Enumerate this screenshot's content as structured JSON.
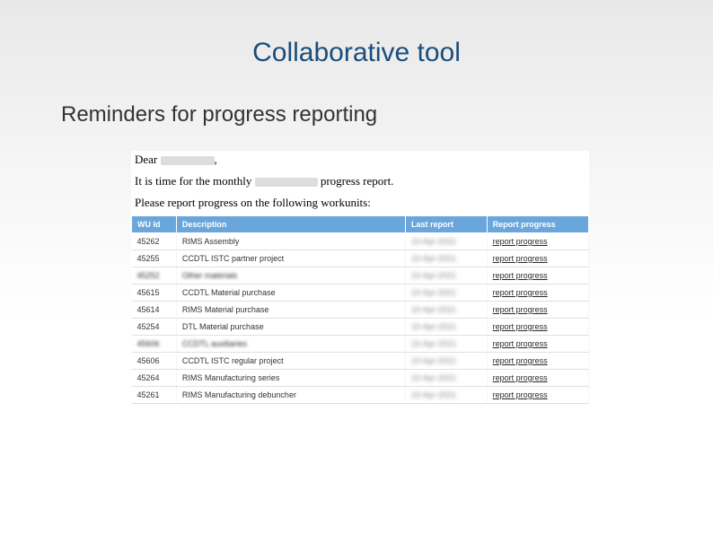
{
  "title": "Collaborative tool",
  "subtitle": "Reminders for progress reporting",
  "email": {
    "greeting_prefix": "Dear",
    "line2_prefix": "It is time for the monthly",
    "line2_suffix": "progress report.",
    "line3": "Please report progress on the following workunits:"
  },
  "table": {
    "headers": {
      "id": "WU Id",
      "desc": "Description",
      "last": "Last report",
      "action": "Report progress"
    },
    "action_label": "report progress",
    "rows": [
      {
        "id": "45262",
        "desc": "RIMS Assembly",
        "last": "10-Apr-2021"
      },
      {
        "id": "45255",
        "desc": "CCDTL ISTC partner project",
        "last": "10-Apr-2021"
      },
      {
        "id": "45252",
        "desc": "Other materials",
        "last": "10-Apr-2021"
      },
      {
        "id": "45615",
        "desc": "CCDTL Material purchase",
        "last": "10-Apr-2021"
      },
      {
        "id": "45614",
        "desc": "RIMS Material purchase",
        "last": "10-Apr-2021"
      },
      {
        "id": "45254",
        "desc": "DTL Material purchase",
        "last": "10-Apr-2021"
      },
      {
        "id": "45606",
        "desc": "CCDTL auxiliaries",
        "last": "10-Apr-2021"
      },
      {
        "id": "45606",
        "desc": "CCDTL ISTC regular project",
        "last": "10-Apr-2021"
      },
      {
        "id": "45264",
        "desc": "RIMS Manufacturing series",
        "last": "10-Apr-2021"
      },
      {
        "id": "45261",
        "desc": "RIMS Manufacturing debuncher",
        "last": "10-Apr-2021"
      }
    ]
  }
}
